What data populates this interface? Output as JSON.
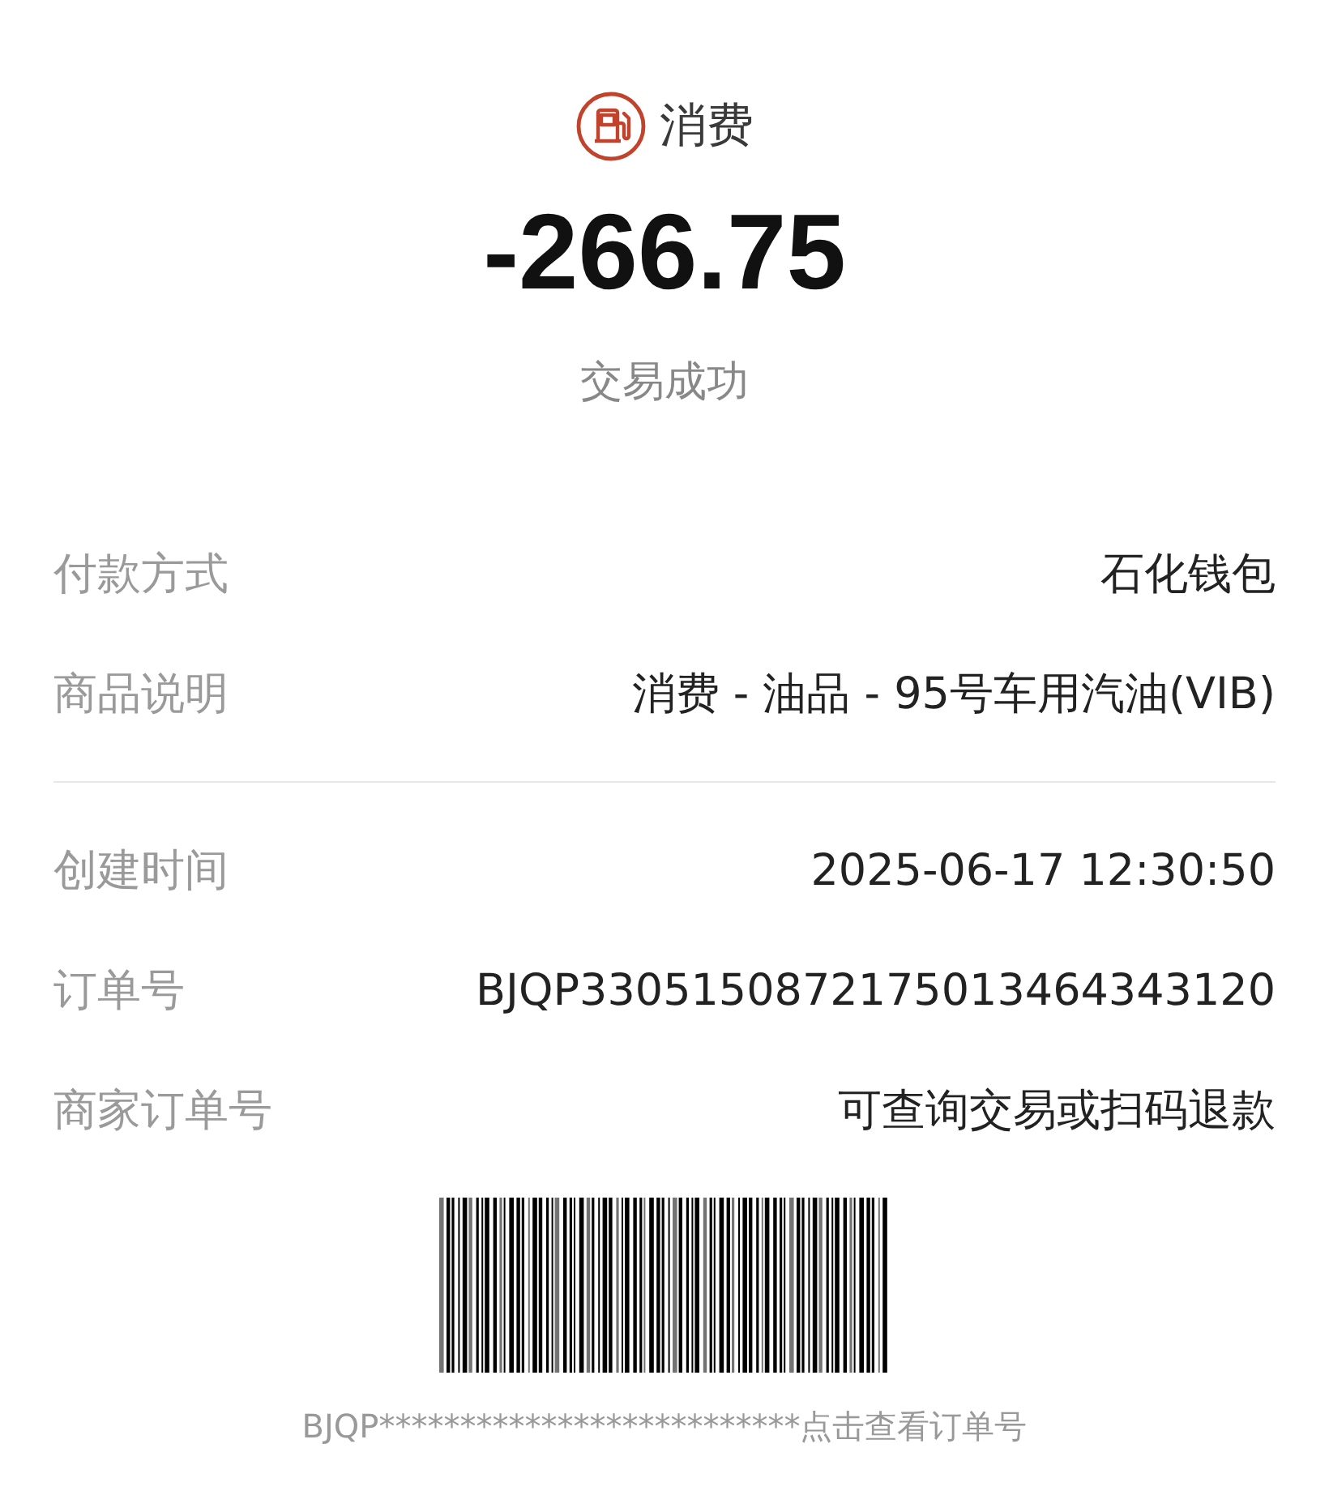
{
  "header": {
    "category": "消费"
  },
  "amount": "-266.75",
  "status": "交易成功",
  "sections": [
    {
      "rows": [
        {
          "label": "付款方式",
          "value": "石化钱包"
        },
        {
          "label": "商品说明",
          "value": "消费 - 油品 - 95号车用汽油(VIB)"
        }
      ]
    },
    {
      "rows": [
        {
          "label": "创建时间",
          "value": "2025-06-17 12:30:50"
        },
        {
          "label": "订单号",
          "value": "BJQP3305150872175013464343120"
        },
        {
          "label": "商家订单号",
          "value": "可查询交易或扫码退款"
        }
      ]
    }
  ],
  "barcode_caption": "BJQP**************************点击查看订单号"
}
